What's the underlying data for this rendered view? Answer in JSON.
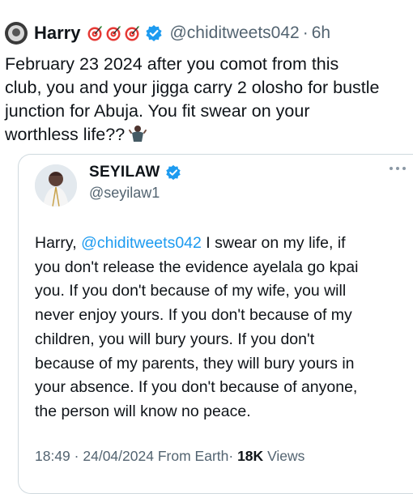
{
  "outer_tweet": {
    "author_name": "Harry",
    "emojis": [
      "target-icon",
      "target-icon",
      "target-icon"
    ],
    "verified": true,
    "handle": "@chiditweets042",
    "separator": "·",
    "time": "6h",
    "text_lines": [
      "February 23 2024 after you comot from this",
      "club, you and your jigga carry 2 olosho for bustle",
      "junction for Abuja. You fit swear on your",
      "worthless life??"
    ],
    "trailing_emoji": "person-shrugging-icon"
  },
  "quoted_tweet": {
    "author_name": "SEYILAW",
    "verified": true,
    "handle": "@seyilaw1",
    "more_icon": "more-icon",
    "text": {
      "line1_prefix": "Harry, ",
      "line1_mention": "@chiditweets042",
      "line1_suffix": " I swear on my life, if",
      "lines": [
        "you don't release the evidence ayelala go kpai",
        "you. If you don't because of my wife, you will",
        "never enjoy yours. If you don't because of my",
        "children, you will bury yours. If you don't",
        "because of my parents, they will bury yours in",
        "your absence. If you don't because of anyone,",
        "the person will know no peace."
      ]
    },
    "meta": {
      "time": "18:49",
      "separator": "·",
      "date": "24/04/2024",
      "source": "From Earth",
      "views_count": "18K",
      "views_label": "Views"
    }
  },
  "colors": {
    "text": "#0f1419",
    "muted": "#536471",
    "accent": "#1d9bf0",
    "border": "#cfd9de"
  }
}
